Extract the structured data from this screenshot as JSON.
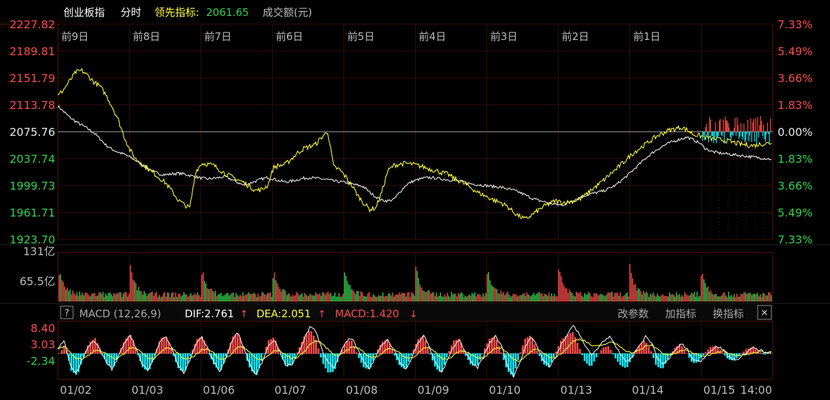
{
  "colors": {
    "bg": "#000000",
    "grid": "#3a0c0c",
    "frame": "#5a1515",
    "up": "#ff4b4b",
    "down": "#2fd24a",
    "yellow": "#ffff33",
    "white": "#f0f0f0",
    "cyan": "#00f0ff",
    "label": "#bbbbbb"
  },
  "header": {
    "name": "创业板指",
    "mode": "分时",
    "lead_label": "领先指标:",
    "lead_value": "2061.65",
    "volume_label": "成交额(元)"
  },
  "chart_data": [
    {
      "type": "line",
      "id": "price",
      "day_labels": [
        "前9日",
        "前8日",
        "前7日",
        "前6日",
        "前5日",
        "前4日",
        "前3日",
        "前2日",
        "前1日"
      ],
      "y_ticks_left": [
        "2227.82",
        "2189.81",
        "2151.79",
        "2113.78",
        "2075.76",
        "2037.74",
        "1999.73",
        "1961.71",
        "1923.70"
      ],
      "y_ticks_right": [
        "7.33%",
        "5.49%",
        "3.66%",
        "1.83%",
        "0.00%",
        "1.83%",
        "3.66%",
        "5.49%",
        "7.33%"
      ],
      "ylim": [
        1923.7,
        2227.82
      ],
      "prev_close": 2075.76,
      "series": [
        {
          "color": "white",
          "values": [
            2112,
            2104,
            2096,
            2090,
            2085,
            2080,
            2074,
            2066,
            2057,
            2051,
            2047,
            2044,
            2040,
            2035,
            2030,
            2024,
            2019,
            2016,
            2015,
            2016,
            2017,
            2016,
            2014,
            2012,
            2010,
            2009,
            2010,
            2011,
            2012,
            2008,
            2004,
            2000,
            2003,
            2006,
            2009,
            2011,
            2009,
            2006,
            2005,
            2006,
            2008,
            2010,
            2011,
            2010,
            2009,
            2008,
            2006,
            2005,
            2004,
            2002,
            2000,
            1998,
            1990,
            1984,
            1979,
            1978,
            1980,
            1990,
            2000,
            2005,
            2008,
            2010,
            2011,
            2010,
            2009,
            2008,
            2007,
            2006,
            2004,
            2002,
            2001,
            2000,
            1999,
            1998,
            1997,
            1995,
            1993,
            1990,
            1986,
            1982,
            1979,
            1977,
            1975,
            1973,
            1972,
            1975,
            1979,
            1983,
            1986,
            1988,
            1990,
            1992,
            1996,
            2000,
            2007,
            2014,
            2022,
            2030,
            2038,
            2045,
            2051,
            2056,
            2060,
            2063,
            2066,
            2068,
            2064,
            2060,
            2052,
            2048,
            2046,
            2045,
            2044,
            2043,
            2042,
            2041,
            2040,
            2039,
            2038,
            2037
          ]
        },
        {
          "color": "yellow",
          "values": [
            2126,
            2136,
            2148,
            2160,
            2162,
            2155,
            2146,
            2140,
            2128,
            2112,
            2094,
            2070,
            2050,
            2037,
            2030,
            2024,
            2017,
            2010,
            2003,
            1992,
            1980,
            1973,
            1968,
            2020,
            2031,
            2030,
            2028,
            2022,
            2016,
            2012,
            2008,
            2004,
            1998,
            1993,
            1994,
            2000,
            2026,
            2028,
            2030,
            2038,
            2046,
            2052,
            2055,
            2058,
            2068,
            2076,
            2026,
            2022,
            2012,
            2000,
            1986,
            1975,
            1966,
            1968,
            1990,
            2020,
            2028,
            2030,
            2031,
            2030,
            2028,
            2026,
            2023,
            2021,
            2018,
            2016,
            2010,
            2006,
            2001,
            1996,
            1990,
            1986,
            1982,
            1978,
            1975,
            1970,
            1962,
            1956,
            1952,
            1958,
            1964,
            1970,
            1974,
            1978,
            1976,
            1976,
            1978,
            1980,
            1986,
            1994,
            2000,
            2007,
            2015,
            2022,
            2030,
            2038,
            2046,
            2052,
            2058,
            2064,
            2070,
            2074,
            2078,
            2080,
            2082,
            2078,
            2072,
            2070,
            2068,
            2066,
            2065,
            2064,
            2062,
            2060,
            2058,
            2057,
            2056,
            2058,
            2059,
            2060
          ]
        }
      ]
    },
    {
      "type": "bar",
      "id": "volume",
      "y_ticks": [
        "131亿",
        "65.5亿"
      ],
      "ylim": [
        0,
        131
      ],
      "unit": "亿"
    },
    {
      "type": "line",
      "id": "macd",
      "title": "MACD (12,26,9)",
      "dif_label": "DIF:2.761",
      "dea_label": "DEA:2.051",
      "macd_label": "MACD:1.420",
      "y_ticks": [
        "8.40",
        "3.03",
        "-2.34"
      ],
      "ylim": [
        -8.5,
        10.5
      ],
      "dif": [
        1.5,
        4.2,
        -3.5,
        -6.8,
        -2.5,
        1.8,
        4.4,
        1.2,
        -2.6,
        -5.2,
        -1.4,
        3.2,
        6.1,
        2.0,
        -3.1,
        -5.6,
        -1.6,
        3.6,
        5.7,
        1.6,
        -3.7,
        -6.2,
        -2.0,
        2.9,
        5.4,
        1.4,
        -2.8,
        -5.8,
        -1.8,
        3.9,
        6.9,
        2.2,
        -3.4,
        -6.9,
        -3.1,
        2.2,
        4.6,
        0.7,
        -3.7,
        -4.1,
        -0.4,
        4.4,
        8.5,
        7.3,
        1.4,
        -3.0,
        -4.6,
        -0.6,
        3.7,
        5.1,
        1.2,
        -2.9,
        -4.9,
        -1.1,
        2.7,
        4.8,
        1.3,
        -2.7,
        -5.2,
        -1.6,
        3.1,
        5.9,
        1.9,
        -3.1,
        -6.3,
        -2.2,
        2.4,
        4.4,
        0.4,
        -3.2,
        -4.6,
        -1.0,
        3.4,
        5.8,
        2.2,
        -3.8,
        -7.6,
        -3.0,
        2.5,
        5.2,
        1.9,
        -2.2,
        -4.4,
        -1.4,
        3.1,
        6.2,
        9.1,
        6.4,
        2.1,
        -0.6,
        1.6,
        4.2,
        5.3,
        2.4,
        -0.8,
        -2.9,
        -0.4,
        2.6,
        5.5,
        3.6,
        -1.5,
        -3.7,
        -1.6,
        1.2,
        3.2,
        1.2,
        -2.1,
        -2.8,
        -0.9,
        1.3,
        2.4,
        1.0,
        -1.2,
        -2.2,
        -1.1,
        0.6,
        1.8,
        1.2,
        0.2,
        0.6
      ]
    }
  ],
  "macd_toolbar": {
    "help": "?",
    "btn_params": "改参数",
    "btn_add": "加指标",
    "btn_switch": "换指标",
    "btn_close": "✕"
  },
  "x_axis": {
    "labels": [
      "01/02",
      "01/03",
      "01/06",
      "01/07",
      "01/08",
      "01/09",
      "01/10",
      "01/13",
      "01/14",
      "01/15",
      "14:00"
    ]
  }
}
